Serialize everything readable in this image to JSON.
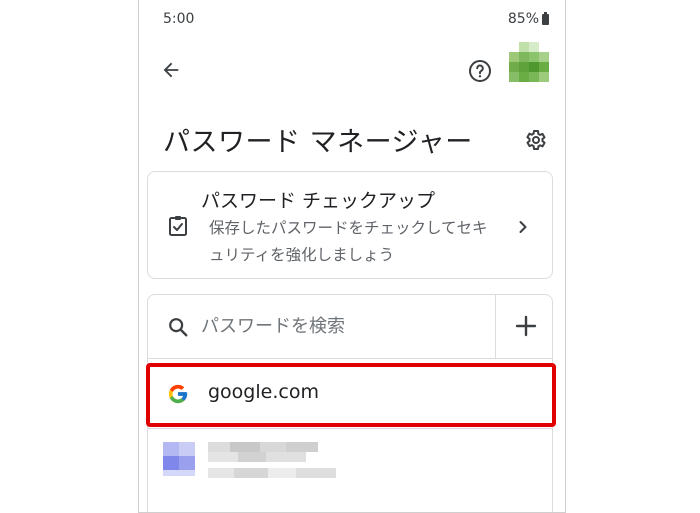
{
  "status_bar": {
    "time": "5:00",
    "battery": "85%"
  },
  "header": {
    "back_icon": "arrow-left-icon",
    "help_icon": "help-circle-icon"
  },
  "page": {
    "title": "パスワード マネージャー",
    "settings_icon": "gear-icon"
  },
  "checkup": {
    "title": "パスワード チェックアップ",
    "description": "保存したパスワードをチェックしてセキュリティを強化しましょう",
    "icon": "clipboard-check-icon",
    "chevron": "chevron-right-icon"
  },
  "search": {
    "placeholder": "パスワードを検索",
    "add_icon": "plus-icon"
  },
  "passwords": [
    {
      "site": "google.com",
      "icon": "google-g-icon",
      "highlighted": true
    }
  ],
  "colors": {
    "highlight": "#e00000",
    "text": "#202124",
    "secondary": "#5f6368",
    "border": "#dadce0"
  }
}
